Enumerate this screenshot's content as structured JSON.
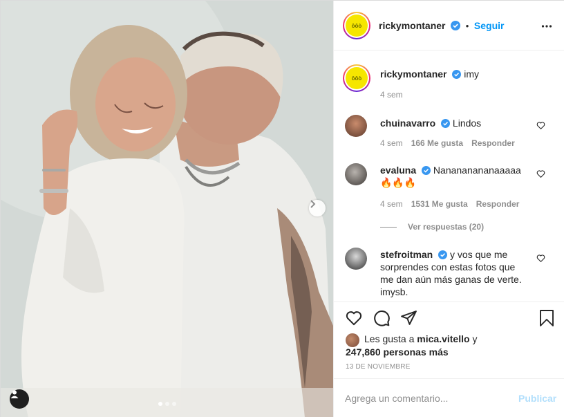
{
  "post": {
    "author": "ricky​montaner",
    "follow_label": "Seguir",
    "separator": "•",
    "avatar_text": "ôôò",
    "caption": {
      "username": "rickymontaner",
      "text": "imy",
      "time": "4 sem"
    },
    "comments": [
      {
        "username": "chuinavarro",
        "text": "Lindos",
        "time": "4 sem",
        "likes": "166 Me gusta",
        "reply": "Responder"
      },
      {
        "username": "evaluna",
        "text": "Nanananananaaaaa🔥🔥🔥",
        "time": "4 sem",
        "likes": "1531 Me gusta",
        "reply": "Responder",
        "view_replies": "Ver respuestas (20)"
      },
      {
        "username": "stefroitman",
        "text": "y vos que me sorprendes con estas fotos que me dan aún más ganas de verte. imysb."
      }
    ],
    "likes": {
      "prefix": "Les gusta a",
      "first_liker": "mica.vitello",
      "conj": "y",
      "count": "247,860 personas más"
    },
    "date": "13 DE NOVIEMBRE",
    "add_comment_placeholder": "Agrega un comentario...",
    "publish_label": "Publicar",
    "carousel": {
      "slides": 3,
      "active": 1
    }
  },
  "colors": {
    "accent": "#0095f6",
    "publish_disabled": "#b2dffc",
    "verified": "#3897f0",
    "avatar_yellow": "#f6e600"
  }
}
